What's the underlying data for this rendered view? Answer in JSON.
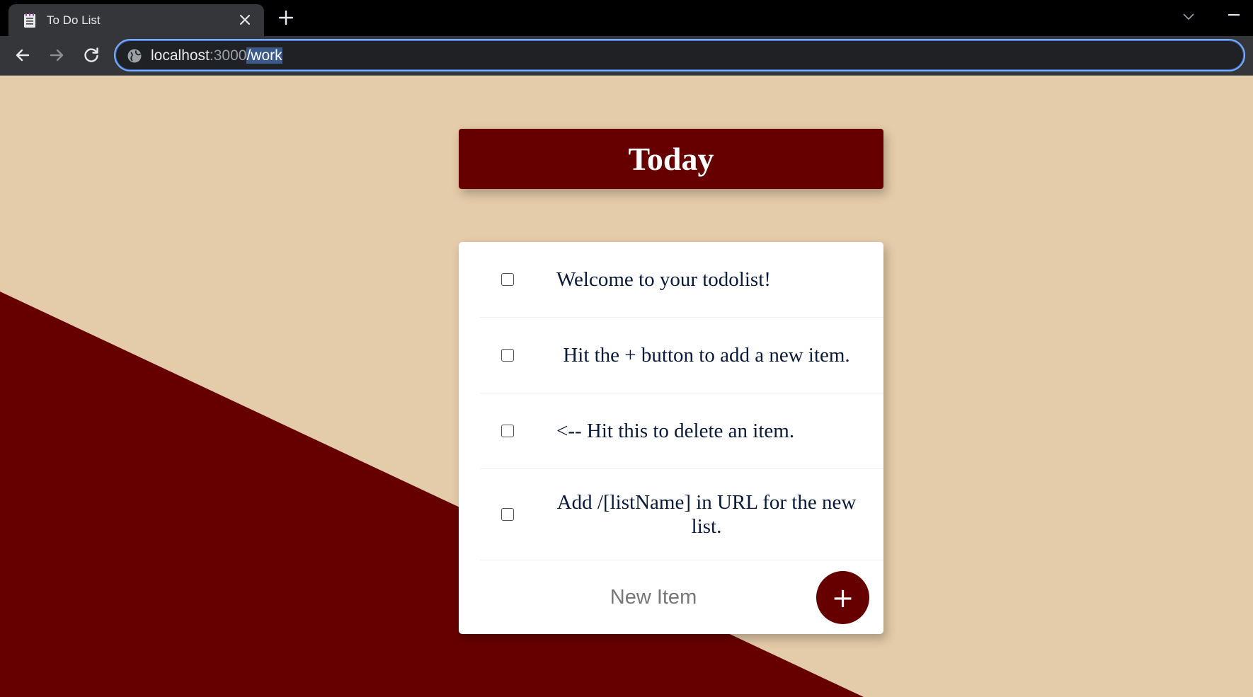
{
  "browser": {
    "tab_title": "To Do List",
    "url_host": "localhost",
    "url_port": ":3000",
    "url_path": "/work",
    "icons": {
      "tab": "notepad-icon",
      "close": "close-icon",
      "new_tab": "plus-icon",
      "back": "back-arrow-icon",
      "forward": "forward-arrow-icon",
      "reload": "reload-icon",
      "site_info": "globe-icon",
      "tabs_menu": "chevron-down-icon",
      "minimize": "minimize-icon"
    }
  },
  "page": {
    "heading": "Today",
    "items": [
      {
        "label": "Welcome to your todolist!",
        "checked": false
      },
      {
        "label": "Hit the + button to add a new item.",
        "checked": false
      },
      {
        "label": "<-- Hit this to delete an item.",
        "checked": false
      },
      {
        "label": "Add /[listName] in URL for the new list.",
        "checked": false
      }
    ],
    "new_item_placeholder": "New Item",
    "add_button_label": "+"
  },
  "colors": {
    "background": "#e4cba9",
    "accent": "#660000",
    "card": "#ffffff",
    "text": "#0a1a3a"
  }
}
